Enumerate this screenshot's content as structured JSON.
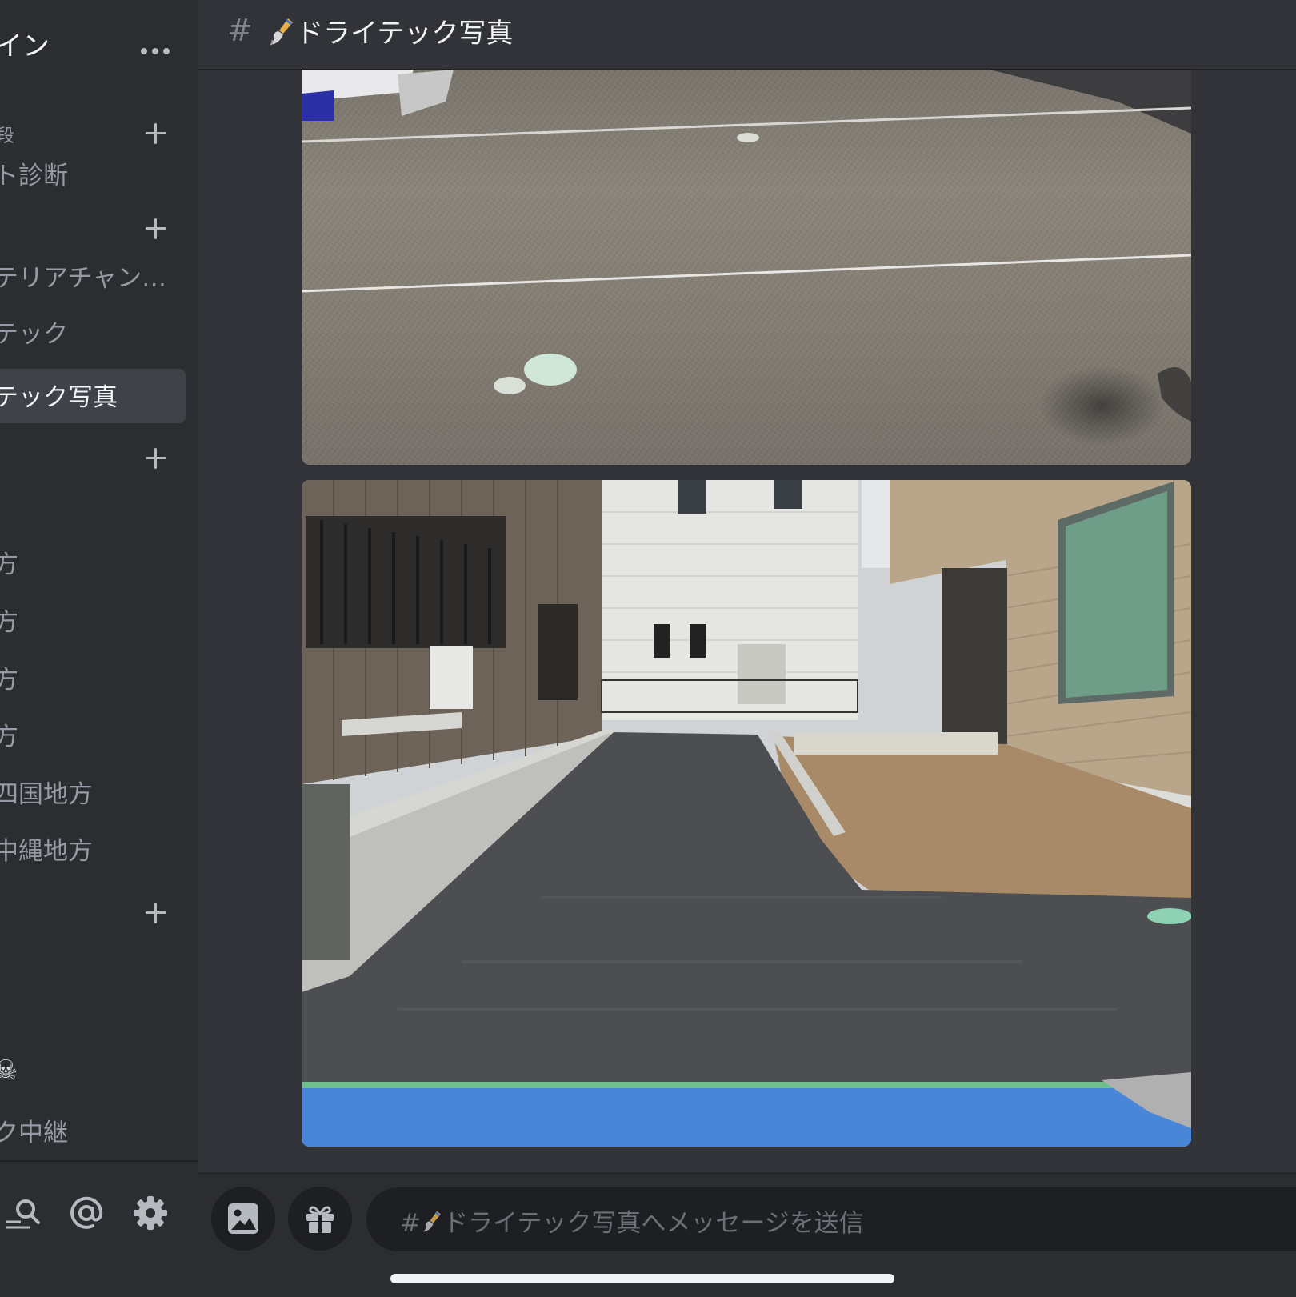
{
  "sidebar": {
    "server_title": "イン",
    "categories": [
      {
        "label": "段"
      },
      {
        "label": ""
      },
      {
        "label": ""
      },
      {
        "label": ""
      }
    ],
    "channels": [
      {
        "label": "ト診断"
      },
      {
        "label": "テリアチャン…"
      },
      {
        "label": "テック"
      },
      {
        "label": "テック写真",
        "active": true
      },
      {
        "label": "方"
      },
      {
        "label": "方"
      },
      {
        "label": "方"
      },
      {
        "label": "方"
      },
      {
        "label": "四国地方"
      },
      {
        "label": "中縄地方"
      },
      {
        "label": "ク中継"
      }
    ],
    "emoji": "☠",
    "bottom_icons": [
      "search-user-icon",
      "mention-icon",
      "settings-gear-icon"
    ]
  },
  "header": {
    "hash": "#",
    "channel_name": "ドライテック写真",
    "channel_icon": "paint-brush-icon"
  },
  "messages": {
    "attachments": [
      {
        "name": "photo-drytec-pavement-closeup"
      },
      {
        "name": "photo-drytec-driveway-completed"
      }
    ]
  },
  "composer": {
    "placeholder": "#🖌ドライテック写真へメッセージを送信",
    "placeholder_text": "ドライテック写真へメッセージを送信",
    "buttons": [
      "image-icon",
      "gift-icon"
    ]
  },
  "colors": {
    "background": "#313338",
    "sidebar": "#2b2d31",
    "active_channel": "#404249",
    "input": "#1e1f22",
    "text_primary": "#f2f3f5",
    "text_muted": "#949ba4"
  }
}
